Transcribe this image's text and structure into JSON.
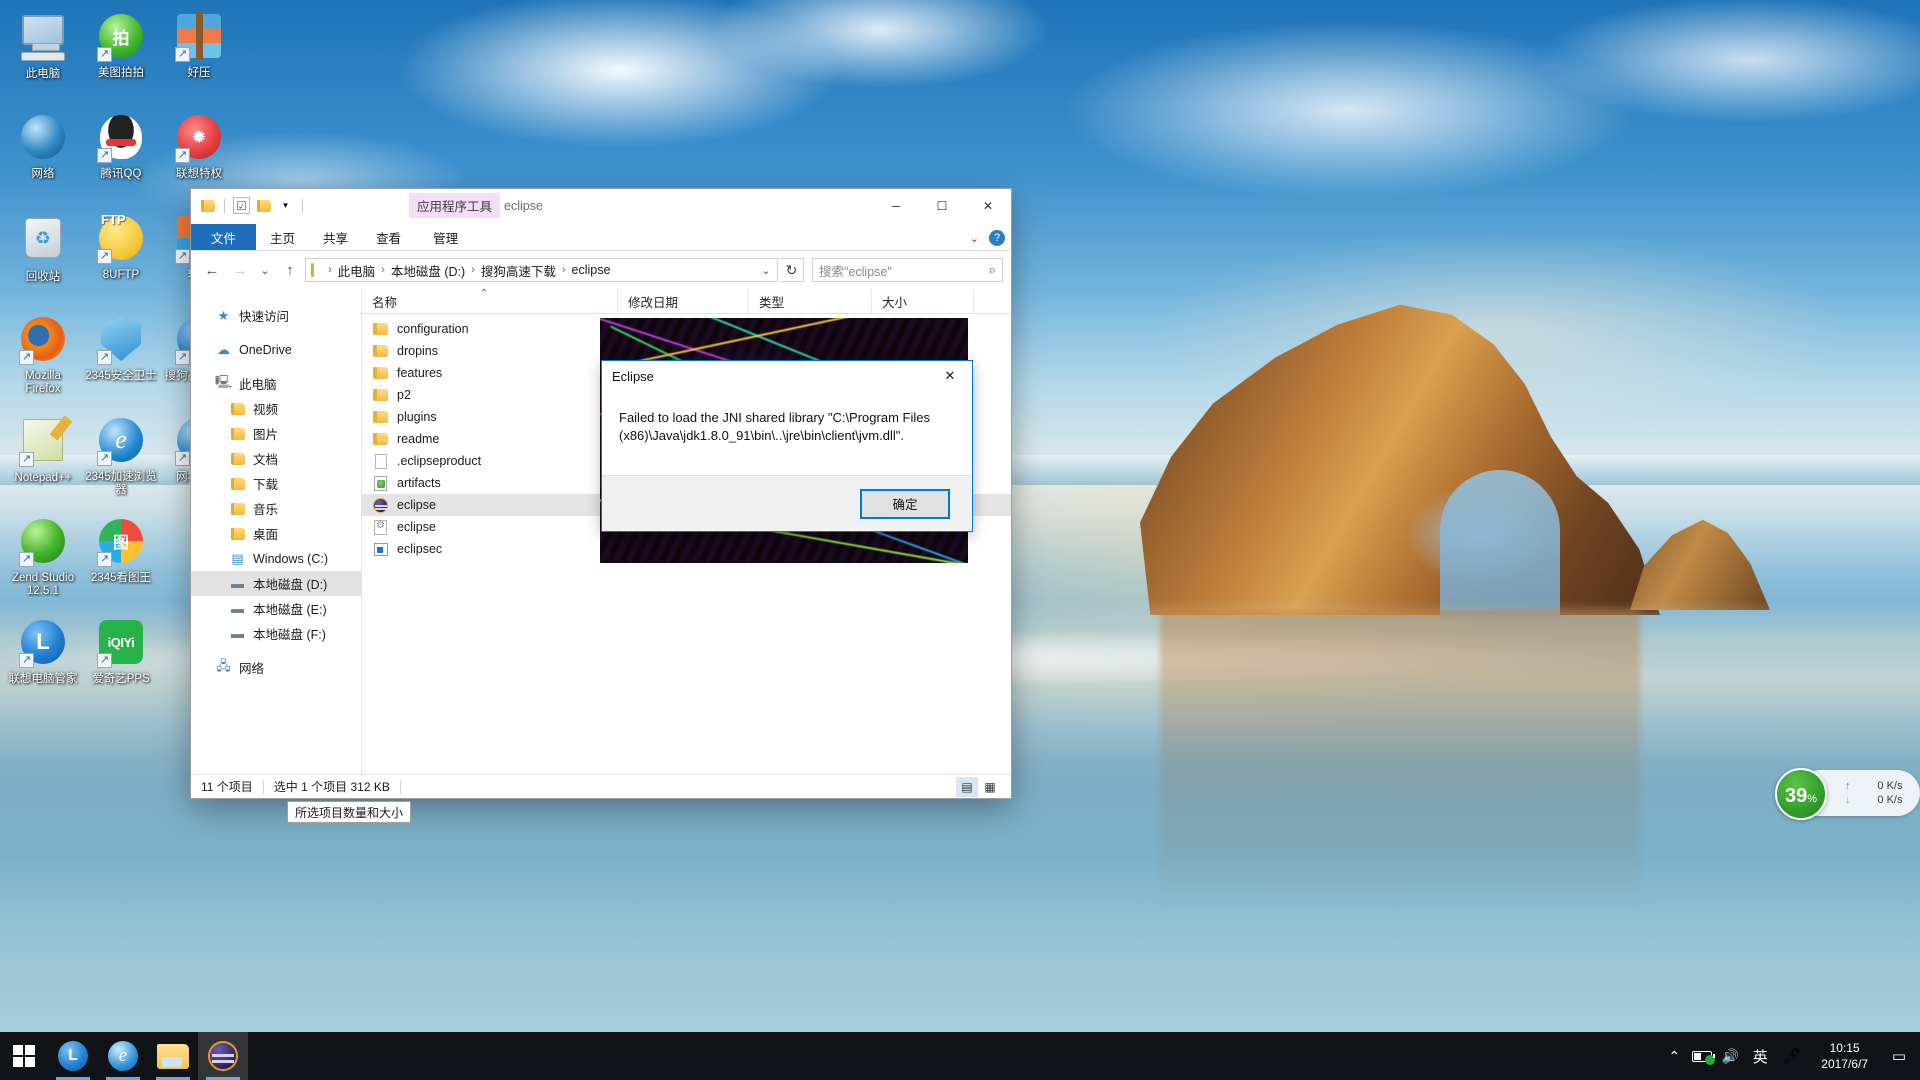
{
  "desktop": {
    "icons": [
      {
        "label": "此电脑",
        "icon": "this-pc-icon",
        "shortcut": false
      },
      {
        "label": "美图拍拍",
        "icon": "meitu-icon",
        "shortcut": true
      },
      {
        "label": "好压",
        "icon": "haozip-icon",
        "shortcut": true
      },
      {
        "label": "网络",
        "icon": "network-icon",
        "shortcut": false
      },
      {
        "label": "腾讯QQ",
        "icon": "qq-icon",
        "shortcut": true
      },
      {
        "label": "联想特权",
        "icon": "lenovo-privilege-icon",
        "shortcut": true
      },
      {
        "label": "回收站",
        "icon": "recycle-bin-icon",
        "shortcut": false
      },
      {
        "label": "8UFTP",
        "icon": "ftp-icon",
        "shortcut": true
      },
      {
        "label": "软件",
        "icon": "software-icon",
        "shortcut": true
      },
      {
        "label": "Mozilla Firefox",
        "icon": "firefox-icon",
        "shortcut": true
      },
      {
        "label": "2345安全卫士",
        "icon": "2345-security-icon",
        "shortcut": true
      },
      {
        "label": "搜狗高速浏览器",
        "icon": "sogou-browser-icon",
        "shortcut": true
      },
      {
        "label": "Notepad++",
        "icon": "notepadpp-icon",
        "shortcut": true
      },
      {
        "label": "2345加速浏览器",
        "icon": "2345-browser-icon",
        "shortcut": true
      },
      {
        "label": "网址导航",
        "icon": "web-nav-icon",
        "shortcut": true
      },
      {
        "label": "Zend Studio 12.5.1",
        "icon": "zend-studio-icon",
        "shortcut": true
      },
      {
        "label": "2345看图王",
        "icon": "2345-pic-icon",
        "shortcut": true
      },
      {
        "label": "",
        "icon": "blank-icon",
        "shortcut": false
      },
      {
        "label": "联想电脑管家",
        "icon": "lenovo-manager-icon",
        "shortcut": true
      },
      {
        "label": "爱奇艺PPS",
        "icon": "iqiyi-pps-icon",
        "shortcut": true
      },
      {
        "label": "",
        "icon": "blank-icon",
        "shortcut": false
      }
    ]
  },
  "explorer": {
    "window_title": "eclipse",
    "contextual_tab_group": "应用程序工具",
    "quick_access": [
      "folder-icon",
      "properties-icon",
      "new-folder-icon",
      "customize-chevron-icon"
    ],
    "tabs": [
      {
        "label": "文件",
        "active": true
      },
      {
        "label": "主页",
        "active": false
      },
      {
        "label": "共享",
        "active": false
      },
      {
        "label": "查看",
        "active": false
      },
      {
        "label": "管理",
        "active": false,
        "contextual": true
      }
    ],
    "window_buttons": {
      "minimize": "─",
      "maximize": "☐",
      "close": "✕"
    },
    "ribbon_collapse": "⌄",
    "help": "?",
    "nav": {
      "back": "←",
      "forward": "→",
      "recent": "⌄",
      "up": "↑"
    },
    "address": {
      "crumbs": [
        "此电脑",
        "本地磁盘 (D:)",
        "搜狗高速下载",
        "eclipse"
      ],
      "separator": "›",
      "dropdown": "⌄",
      "refresh": "↻"
    },
    "search": {
      "value": "搜索\"eclipse\"",
      "icon": "search-icon"
    },
    "sidebar": [
      {
        "label": "快速访问",
        "icon": "star-icon",
        "indent": false,
        "selected": false
      },
      {
        "label": "OneDrive",
        "icon": "cloud-icon",
        "indent": false,
        "selected": false
      },
      {
        "label": "此电脑",
        "icon": "pc-icon",
        "indent": false,
        "selected": false
      },
      {
        "label": "视频",
        "icon": "video-folder-icon",
        "indent": true,
        "selected": false
      },
      {
        "label": "图片",
        "icon": "pictures-folder-icon",
        "indent": true,
        "selected": false
      },
      {
        "label": "文档",
        "icon": "documents-folder-icon",
        "indent": true,
        "selected": false
      },
      {
        "label": "下载",
        "icon": "downloads-folder-icon",
        "indent": true,
        "selected": false
      },
      {
        "label": "音乐",
        "icon": "music-folder-icon",
        "indent": true,
        "selected": false
      },
      {
        "label": "桌面",
        "icon": "desktop-folder-icon",
        "indent": true,
        "selected": false
      },
      {
        "label": "Windows (C:)",
        "icon": "windows-drive-icon",
        "indent": true,
        "selected": false
      },
      {
        "label": "本地磁盘 (D:)",
        "icon": "drive-icon",
        "indent": true,
        "selected": true
      },
      {
        "label": "本地磁盘 (E:)",
        "icon": "drive-icon",
        "indent": true,
        "selected": false
      },
      {
        "label": "本地磁盘 (F:)",
        "icon": "drive-icon",
        "indent": true,
        "selected": false
      },
      {
        "label": "网络",
        "icon": "network-icon",
        "indent": false,
        "selected": false
      }
    ],
    "columns": [
      {
        "label": "名称",
        "key": "name",
        "sorted": true
      },
      {
        "label": "修改日期",
        "key": "date"
      },
      {
        "label": "类型",
        "key": "type"
      },
      {
        "label": "大小",
        "key": "size"
      }
    ],
    "files": [
      {
        "name": "configuration",
        "icon": "folder-icon",
        "selected": false
      },
      {
        "name": "dropins",
        "icon": "folder-icon",
        "selected": false
      },
      {
        "name": "features",
        "icon": "folder-icon",
        "selected": false
      },
      {
        "name": "p2",
        "icon": "folder-icon",
        "selected": false
      },
      {
        "name": "plugins",
        "icon": "folder-icon",
        "selected": false
      },
      {
        "name": "readme",
        "icon": "folder-icon",
        "selected": false
      },
      {
        "name": ".eclipseproduct",
        "icon": "file-icon",
        "selected": false
      },
      {
        "name": "artifacts",
        "icon": "xml-file-icon",
        "selected": false
      },
      {
        "name": "eclipse",
        "icon": "eclipse-app-icon",
        "selected": true
      },
      {
        "name": "eclipse",
        "icon": "config-file-icon",
        "selected": false
      },
      {
        "name": "eclipsec",
        "icon": "console-app-icon",
        "selected": false
      }
    ],
    "status": {
      "item_count": "11 个项目",
      "selection": "选中 1 个项目  312 KB"
    },
    "view_buttons": [
      {
        "icon": "details-view-icon",
        "active": true
      },
      {
        "icon": "large-icons-view-icon",
        "active": false
      }
    ],
    "tooltip": "所选项目数量和大小"
  },
  "dialog": {
    "title": "Eclipse",
    "close": "✕",
    "message": "Failed to load the JNI shared library \"C:\\Program Files (x86)\\Java\\jdk1.8.0_91\\bin\\..\\jre\\bin\\client\\jvm.dll\".",
    "ok_button": "确定"
  },
  "speed_widget": {
    "cpu_percent": "39",
    "percent_symbol": "%",
    "upload": "0 K/s",
    "download": "0 K/s",
    "upload_arrow": "↑",
    "download_arrow": "↓",
    "circle_color": "#2f9e2a"
  },
  "taskbar": {
    "start": "windows-logo-icon",
    "items": [
      {
        "icon": "lenovo-icon",
        "active": false,
        "running": true
      },
      {
        "icon": "browser-icon",
        "active": false,
        "running": true
      },
      {
        "icon": "file-explorer-icon",
        "active": false,
        "running": true
      },
      {
        "icon": "eclipse-icon",
        "active": true,
        "running": true
      }
    ],
    "tray": {
      "chevron": "⌃",
      "battery": "battery-icon",
      "volume": "🔊",
      "ime": "英",
      "pen": "pen-tool-icon",
      "time": "10:15",
      "date": "2017/6/7",
      "notification": "▭"
    }
  }
}
